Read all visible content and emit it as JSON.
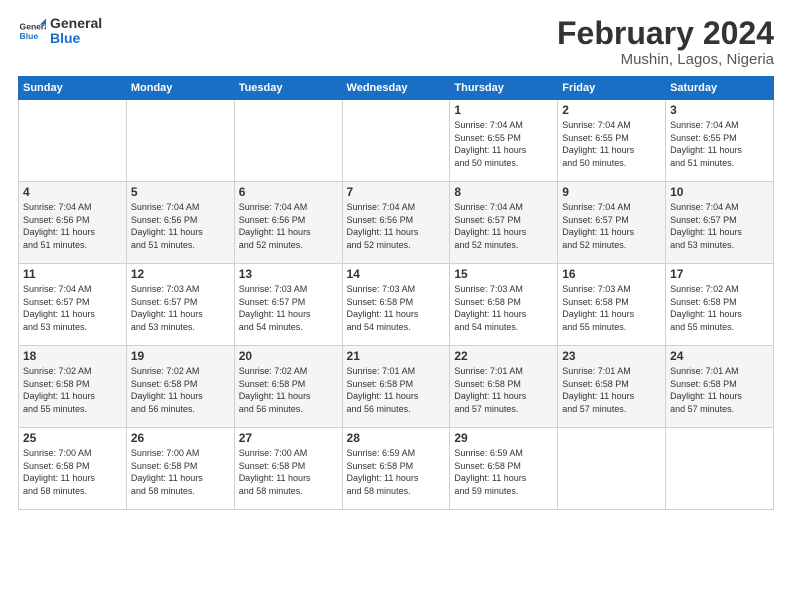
{
  "logo": {
    "text_general": "General",
    "text_blue": "Blue"
  },
  "header": {
    "title": "February 2024",
    "subtitle": "Mushin, Lagos, Nigeria"
  },
  "weekdays": [
    "Sunday",
    "Monday",
    "Tuesday",
    "Wednesday",
    "Thursday",
    "Friday",
    "Saturday"
  ],
  "weeks": [
    [
      {
        "day": "",
        "info": ""
      },
      {
        "day": "",
        "info": ""
      },
      {
        "day": "",
        "info": ""
      },
      {
        "day": "",
        "info": ""
      },
      {
        "day": "1",
        "info": "Sunrise: 7:04 AM\nSunset: 6:55 PM\nDaylight: 11 hours\nand 50 minutes."
      },
      {
        "day": "2",
        "info": "Sunrise: 7:04 AM\nSunset: 6:55 PM\nDaylight: 11 hours\nand 50 minutes."
      },
      {
        "day": "3",
        "info": "Sunrise: 7:04 AM\nSunset: 6:55 PM\nDaylight: 11 hours\nand 51 minutes."
      }
    ],
    [
      {
        "day": "4",
        "info": "Sunrise: 7:04 AM\nSunset: 6:56 PM\nDaylight: 11 hours\nand 51 minutes."
      },
      {
        "day": "5",
        "info": "Sunrise: 7:04 AM\nSunset: 6:56 PM\nDaylight: 11 hours\nand 51 minutes."
      },
      {
        "day": "6",
        "info": "Sunrise: 7:04 AM\nSunset: 6:56 PM\nDaylight: 11 hours\nand 52 minutes."
      },
      {
        "day": "7",
        "info": "Sunrise: 7:04 AM\nSunset: 6:56 PM\nDaylight: 11 hours\nand 52 minutes."
      },
      {
        "day": "8",
        "info": "Sunrise: 7:04 AM\nSunset: 6:57 PM\nDaylight: 11 hours\nand 52 minutes."
      },
      {
        "day": "9",
        "info": "Sunrise: 7:04 AM\nSunset: 6:57 PM\nDaylight: 11 hours\nand 52 minutes."
      },
      {
        "day": "10",
        "info": "Sunrise: 7:04 AM\nSunset: 6:57 PM\nDaylight: 11 hours\nand 53 minutes."
      }
    ],
    [
      {
        "day": "11",
        "info": "Sunrise: 7:04 AM\nSunset: 6:57 PM\nDaylight: 11 hours\nand 53 minutes."
      },
      {
        "day": "12",
        "info": "Sunrise: 7:03 AM\nSunset: 6:57 PM\nDaylight: 11 hours\nand 53 minutes."
      },
      {
        "day": "13",
        "info": "Sunrise: 7:03 AM\nSunset: 6:57 PM\nDaylight: 11 hours\nand 54 minutes."
      },
      {
        "day": "14",
        "info": "Sunrise: 7:03 AM\nSunset: 6:58 PM\nDaylight: 11 hours\nand 54 minutes."
      },
      {
        "day": "15",
        "info": "Sunrise: 7:03 AM\nSunset: 6:58 PM\nDaylight: 11 hours\nand 54 minutes."
      },
      {
        "day": "16",
        "info": "Sunrise: 7:03 AM\nSunset: 6:58 PM\nDaylight: 11 hours\nand 55 minutes."
      },
      {
        "day": "17",
        "info": "Sunrise: 7:02 AM\nSunset: 6:58 PM\nDaylight: 11 hours\nand 55 minutes."
      }
    ],
    [
      {
        "day": "18",
        "info": "Sunrise: 7:02 AM\nSunset: 6:58 PM\nDaylight: 11 hours\nand 55 minutes."
      },
      {
        "day": "19",
        "info": "Sunrise: 7:02 AM\nSunset: 6:58 PM\nDaylight: 11 hours\nand 56 minutes."
      },
      {
        "day": "20",
        "info": "Sunrise: 7:02 AM\nSunset: 6:58 PM\nDaylight: 11 hours\nand 56 minutes."
      },
      {
        "day": "21",
        "info": "Sunrise: 7:01 AM\nSunset: 6:58 PM\nDaylight: 11 hours\nand 56 minutes."
      },
      {
        "day": "22",
        "info": "Sunrise: 7:01 AM\nSunset: 6:58 PM\nDaylight: 11 hours\nand 57 minutes."
      },
      {
        "day": "23",
        "info": "Sunrise: 7:01 AM\nSunset: 6:58 PM\nDaylight: 11 hours\nand 57 minutes."
      },
      {
        "day": "24",
        "info": "Sunrise: 7:01 AM\nSunset: 6:58 PM\nDaylight: 11 hours\nand 57 minutes."
      }
    ],
    [
      {
        "day": "25",
        "info": "Sunrise: 7:00 AM\nSunset: 6:58 PM\nDaylight: 11 hours\nand 58 minutes."
      },
      {
        "day": "26",
        "info": "Sunrise: 7:00 AM\nSunset: 6:58 PM\nDaylight: 11 hours\nand 58 minutes."
      },
      {
        "day": "27",
        "info": "Sunrise: 7:00 AM\nSunset: 6:58 PM\nDaylight: 11 hours\nand 58 minutes."
      },
      {
        "day": "28",
        "info": "Sunrise: 6:59 AM\nSunset: 6:58 PM\nDaylight: 11 hours\nand 58 minutes."
      },
      {
        "day": "29",
        "info": "Sunrise: 6:59 AM\nSunset: 6:58 PM\nDaylight: 11 hours\nand 59 minutes."
      },
      {
        "day": "",
        "info": ""
      },
      {
        "day": "",
        "info": ""
      }
    ]
  ]
}
